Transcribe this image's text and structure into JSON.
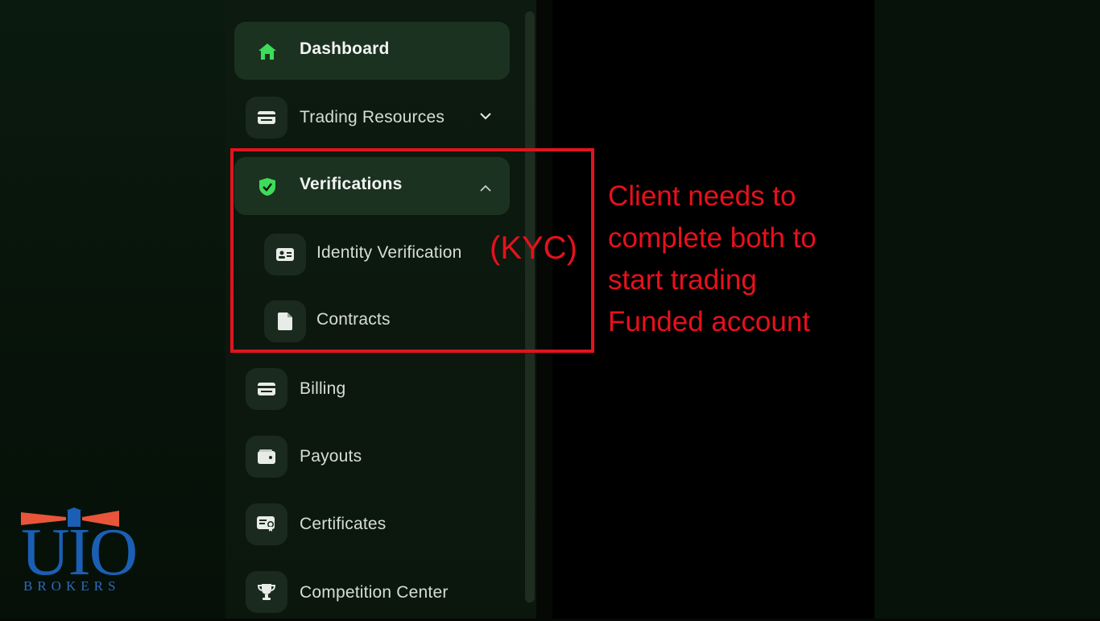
{
  "sidebar": {
    "items": [
      {
        "label": "Dashboard",
        "icon": "home-icon",
        "active": true
      },
      {
        "label": "Trading Resources",
        "icon": "card-icon",
        "expandable": true
      },
      {
        "label": "Verifications",
        "icon": "shield-check-icon",
        "active": true,
        "expanded": true
      },
      {
        "label": "Billing",
        "icon": "card-icon"
      },
      {
        "label": "Payouts",
        "icon": "wallet-icon"
      },
      {
        "label": "Certificates",
        "icon": "certificate-icon"
      },
      {
        "label": "Competition Center",
        "icon": "trophy-icon"
      }
    ],
    "verification_subitems": [
      {
        "label": "Identity Verification",
        "icon": "id-card-icon"
      },
      {
        "label": "Contracts",
        "icon": "document-icon"
      }
    ]
  },
  "annotation": {
    "kyc": "(KYC)",
    "lines": [
      "Client needs to",
      "complete both to",
      "start trading",
      "Funded account"
    ],
    "color": "#e8101c"
  },
  "logo": {
    "letters": "UIO",
    "sub": "BROKERS",
    "color": "#1a5fb4"
  },
  "colors": {
    "accent": "#3ddc5a",
    "background": "#050805"
  }
}
